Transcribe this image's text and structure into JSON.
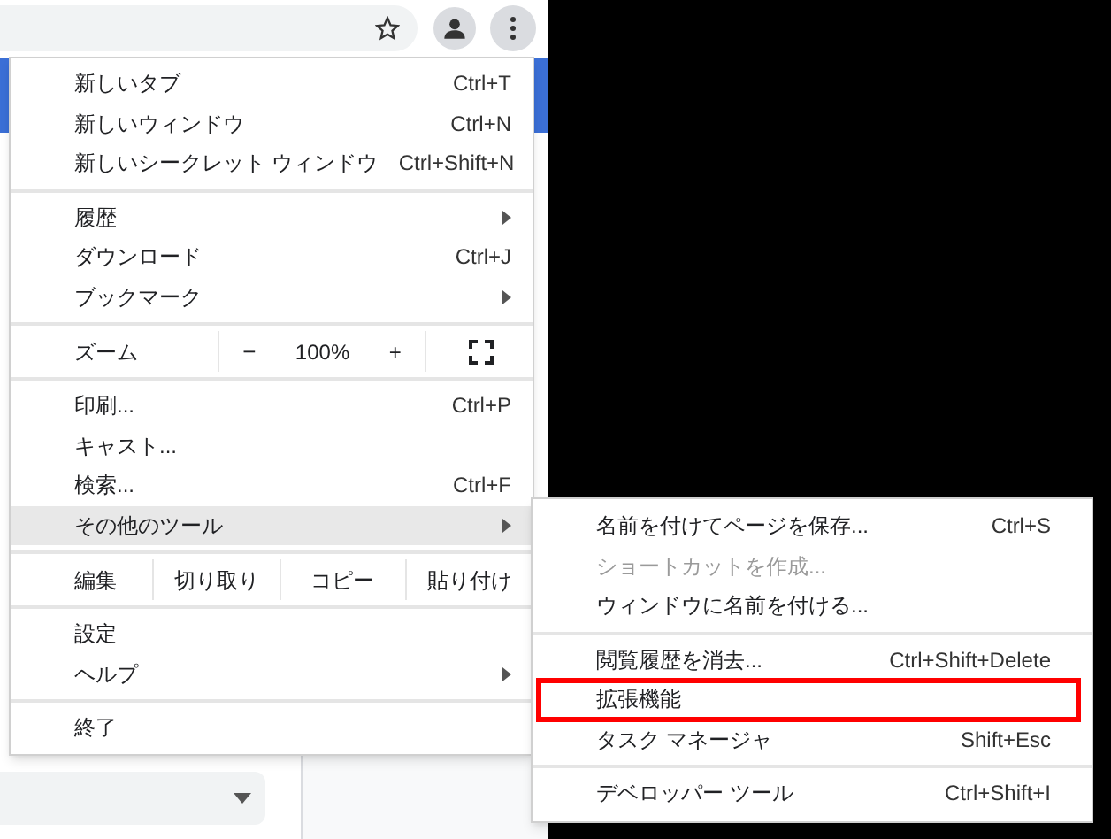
{
  "menu": {
    "items": [
      {
        "kind": "item",
        "label": "新しいタブ",
        "shortcut": "Ctrl+T"
      },
      {
        "kind": "item",
        "label": "新しいウィンドウ",
        "shortcut": "Ctrl+N"
      },
      {
        "kind": "item",
        "label": "新しいシークレット ウィンドウ",
        "shortcut": "Ctrl+Shift+N"
      },
      {
        "kind": "separator"
      },
      {
        "kind": "item",
        "label": "履歴",
        "submenu": true
      },
      {
        "kind": "item",
        "label": "ダウンロード",
        "shortcut": "Ctrl+J"
      },
      {
        "kind": "item",
        "label": "ブックマーク",
        "submenu": true
      },
      {
        "kind": "separator"
      },
      {
        "kind": "zoom",
        "label": "ズーム",
        "minus": "−",
        "value": "100%",
        "plus": "+"
      },
      {
        "kind": "separator"
      },
      {
        "kind": "item",
        "label": "印刷...",
        "shortcut": "Ctrl+P"
      },
      {
        "kind": "item",
        "label": "キャスト..."
      },
      {
        "kind": "item",
        "label": "検索...",
        "shortcut": "Ctrl+F"
      },
      {
        "kind": "item",
        "label": "その他のツール",
        "submenu": true,
        "selected": true
      },
      {
        "kind": "separator"
      },
      {
        "kind": "edit",
        "label": "編集",
        "buttons": [
          "切り取り",
          "コピー",
          "貼り付け"
        ]
      },
      {
        "kind": "separator"
      },
      {
        "kind": "item",
        "label": "設定"
      },
      {
        "kind": "item",
        "label": "ヘルプ",
        "submenu": true
      },
      {
        "kind": "separator"
      },
      {
        "kind": "item",
        "label": "終了"
      }
    ]
  },
  "submenu": {
    "items": [
      {
        "kind": "item",
        "label": "名前を付けてページを保存...",
        "shortcut": "Ctrl+S"
      },
      {
        "kind": "item",
        "label": "ショートカットを作成...",
        "disabled": true
      },
      {
        "kind": "item",
        "label": "ウィンドウに名前を付ける..."
      },
      {
        "kind": "separator"
      },
      {
        "kind": "item",
        "label": "閲覧履歴を消去...",
        "shortcut": "Ctrl+Shift+Delete"
      },
      {
        "kind": "item",
        "label": "拡張機能",
        "highlighted": true
      },
      {
        "kind": "item",
        "label": "タスク マネージャ",
        "shortcut": "Shift+Esc"
      },
      {
        "kind": "separator"
      },
      {
        "kind": "item",
        "label": "デベロッパー ツール",
        "shortcut": "Ctrl+Shift+I"
      }
    ]
  }
}
